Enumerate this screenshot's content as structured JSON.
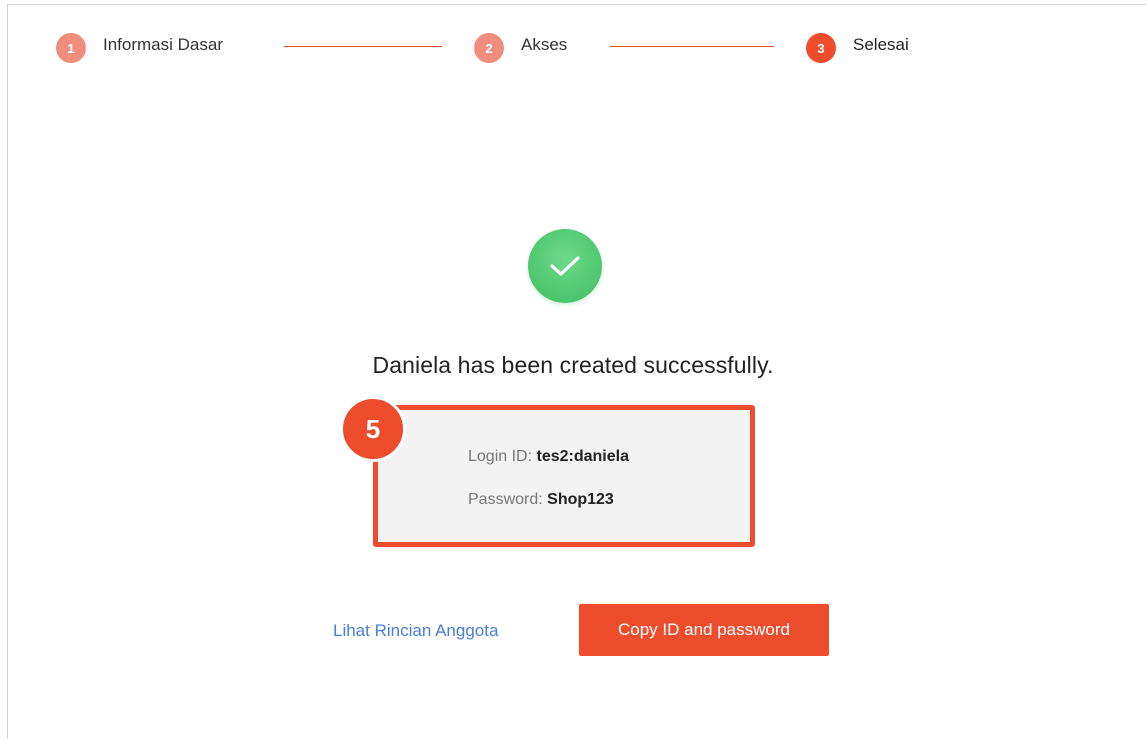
{
  "stepper": {
    "steps": [
      {
        "number": "1",
        "label": "Informasi Dasar",
        "state": "done"
      },
      {
        "number": "2",
        "label": "Akses",
        "state": "done"
      },
      {
        "number": "3",
        "label": "Selesai",
        "state": "active"
      }
    ]
  },
  "success": {
    "icon": "check-icon",
    "message": "Daniela has been created successfully."
  },
  "credentials": {
    "badge": "5",
    "login_label": "Login ID:",
    "login_value": "tes2:daniela",
    "password_label": "Password:",
    "password_value": "Shop123"
  },
  "actions": {
    "details_link": "Lihat Rincian Anggota",
    "copy_button": "Copy ID and password"
  },
  "colors": {
    "accent": "#ee4d2d",
    "step_done": "#f08d7c",
    "success": "#4cc56c",
    "link": "#4a7ed8"
  }
}
